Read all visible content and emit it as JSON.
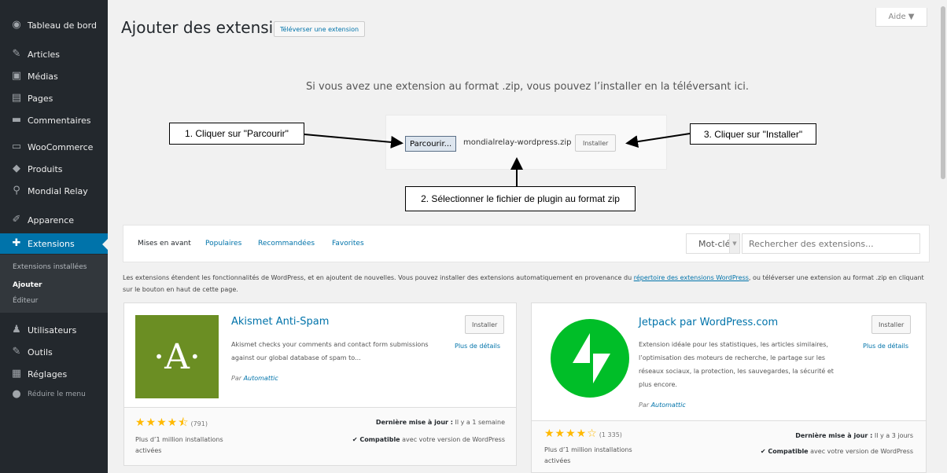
{
  "sidebar": {
    "items": [
      {
        "label": "Tableau de bord",
        "icon": "dashboard-icon",
        "glyph": "◉"
      },
      {
        "label": "Articles",
        "icon": "pin-icon",
        "glyph": "✎"
      },
      {
        "label": "Médias",
        "icon": "media-icon",
        "glyph": "▣"
      },
      {
        "label": "Pages",
        "icon": "pages-icon",
        "glyph": "▤"
      },
      {
        "label": "Commentaires",
        "icon": "comment-icon",
        "glyph": "▬"
      },
      {
        "label": "WooCommerce",
        "icon": "woocommerce-icon",
        "glyph": "▭"
      },
      {
        "label": "Produits",
        "icon": "products-icon",
        "glyph": "◆"
      },
      {
        "label": "Mondial Relay",
        "icon": "location-pin-icon",
        "glyph": "⚲"
      },
      {
        "label": "Apparence",
        "icon": "brush-icon",
        "glyph": "✐"
      },
      {
        "label": "Extensions",
        "icon": "plugin-icon",
        "glyph": "✚"
      },
      {
        "label": "Utilisateurs",
        "icon": "users-icon",
        "glyph": "♟"
      },
      {
        "label": "Outils",
        "icon": "wrench-icon",
        "glyph": "✎"
      },
      {
        "label": "Réglages",
        "icon": "settings-icon",
        "glyph": "▦"
      }
    ],
    "submenu": [
      "Extensions installées",
      "Ajouter",
      "Éditeur"
    ],
    "collapse_label": "Réduire le menu"
  },
  "header": {
    "title": "Ajouter des extensions",
    "upload_button": "Téléverser une extension",
    "help": "Aide ▼"
  },
  "upload": {
    "instructions": "Si vous avez une extension au format .zip, vous pouvez l’installer en la téléversant ici.",
    "browse_label": "Parcourir...",
    "file_name": "mondialrelay-wordpress.zip",
    "install_label": "Installer"
  },
  "callouts": {
    "step1": "1. Cliquer sur \"Parcourir\"",
    "step2": "2. Sélectionner le fichier de plugin au format zip",
    "step3": "3. Cliquer sur \"Installer\""
  },
  "filters": {
    "tabs": [
      "Mises en avant",
      "Populaires",
      "Recommandées",
      "Favorites"
    ],
    "search_type": "Mot-clé",
    "search_placeholder": "Rechercher des extensions..."
  },
  "intro": {
    "before_link": "Les extensions étendent les fonctionnalités de WordPress, et en ajoutent de nouvelles. Vous pouvez installer des extensions automatiquement en provenance du ",
    "link": "répertoire des extensions WordPress",
    "after_link": ", ou téléverser une extension au format .zip en cliquant sur le bouton en haut de cette page."
  },
  "plugins": [
    {
      "name": "Akismet Anti-Spam",
      "description": "Akismet checks your comments and contact form submissions against our global database of spam to...",
      "author_prefix": "Par",
      "author": "Automattic",
      "install": "Installer",
      "details": "Plus de détails",
      "stars": "★★★★⯪",
      "rating_count": "(791)",
      "installs": "Plus d’1 million installations activées",
      "updated_label": "Dernière mise à jour :",
      "updated_value": " Il y a 1 semaine",
      "compat_label": "✔ Compatible",
      "compat_value": " avec votre version de WordPress",
      "icon_color": "#6b8e23"
    },
    {
      "name": "Jetpack par WordPress.com",
      "description": "Extension idéale pour les statistiques, les articles similaires, l’optimisation des moteurs de recherche, le partage sur les réseaux sociaux, la protection, les sauvegardes, la sécurité et plus encore.",
      "author_prefix": "Par",
      "author": "Automattic",
      "install": "Installer",
      "details": "Plus de détails",
      "stars": "★★★★☆",
      "rating_count": "(1 335)",
      "installs": "Plus d’1 million installations activées",
      "updated_label": "Dernière mise à jour :",
      "updated_value": " Il y a 3 jours",
      "compat_label": "✔ Compatible",
      "compat_value": " avec votre version de WordPress",
      "icon_color": "#00be28"
    }
  ],
  "colors": {
    "sidebar_bg": "#23282d",
    "accent": "#0073aa",
    "star": "#ffb900"
  }
}
